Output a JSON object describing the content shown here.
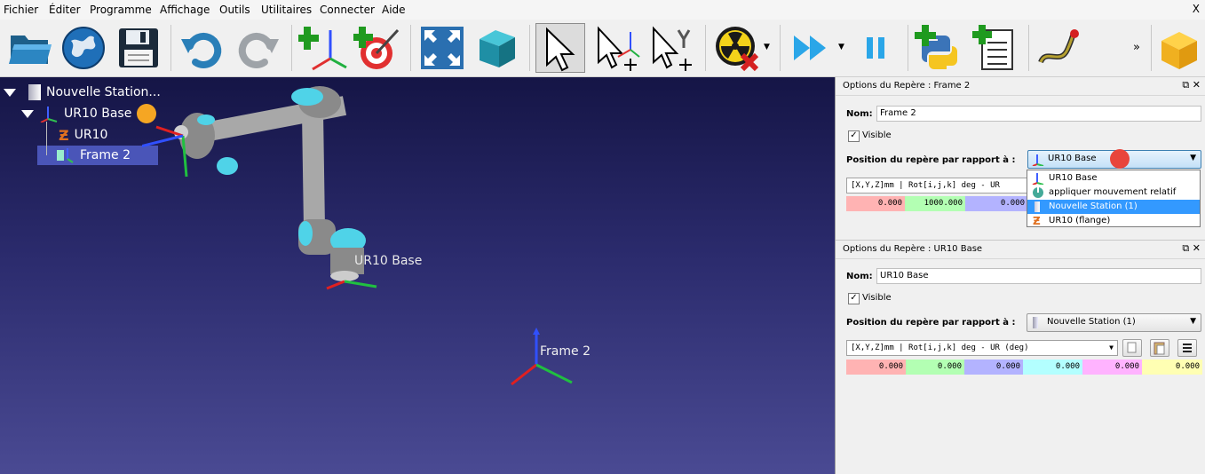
{
  "menu": {
    "items": [
      "Fichier",
      "Éditer",
      "Programme",
      "Affichage",
      "Outils",
      "Utilitaires",
      "Connecter",
      "Aide"
    ],
    "close": "X"
  },
  "toolbar": {
    "icons": [
      "open-folder-icon",
      "globe-icon",
      "save-icon",
      "undo-icon",
      "redo-icon",
      "add-frame-icon",
      "add-target-icon",
      "fit-all-icon",
      "box-view-icon",
      "select-icon",
      "move-frame-icon",
      "move-tool-icon",
      "collision-icon",
      "run-program-icon",
      "pause-icon",
      "add-python-icon",
      "add-program-icon",
      "path-icon",
      "package-icon"
    ],
    "overflow": "»"
  },
  "tree": {
    "station": "Nouvelle Station...",
    "robot_base": "UR10 Base",
    "robot": "UR10",
    "frame": "Frame 2"
  },
  "viewport": {
    "label_base": "UR10 Base",
    "label_frame": "Frame 2"
  },
  "panel1": {
    "title": "Options du Repère : Frame 2",
    "name_label": "Nom:",
    "name_value": "Frame 2",
    "visible_label": "Visible",
    "position_label": "Position du repère par rapport à :",
    "reference_selected": "UR10 Base",
    "format_label": "[X,Y,Z]mm | Rot[i,j,k] deg   - UR",
    "values": [
      "0.000",
      "1000.000",
      "0.000"
    ]
  },
  "dropdown": {
    "items": [
      "UR10 Base",
      "appliquer mouvement relatif",
      "Nouvelle Station (1)",
      "UR10 (flange)"
    ],
    "selected_index": 2
  },
  "panel2": {
    "title": "Options du Repère : UR10 Base",
    "name_label": "Nom:",
    "name_value": "UR10 Base",
    "visible_label": "Visible",
    "position_label": "Position du repère par rapport à :",
    "reference_selected": "Nouvelle Station (1)",
    "format_label": "[X,Y,Z]mm | Rot[i,j,k] deg   - UR (deg)",
    "values": [
      "0.000",
      "0.000",
      "0.000",
      "0.000",
      "0.000",
      "0.000"
    ]
  },
  "colors": {
    "x": "#ffb3b3",
    "y": "#b3ffb3",
    "z": "#b3b3ff",
    "rx": "#b3ffff",
    "ry": "#ffb3ff",
    "rz": "#ffffb3",
    "selection": "#3399ff",
    "accent_cursor": "#f5a623"
  }
}
